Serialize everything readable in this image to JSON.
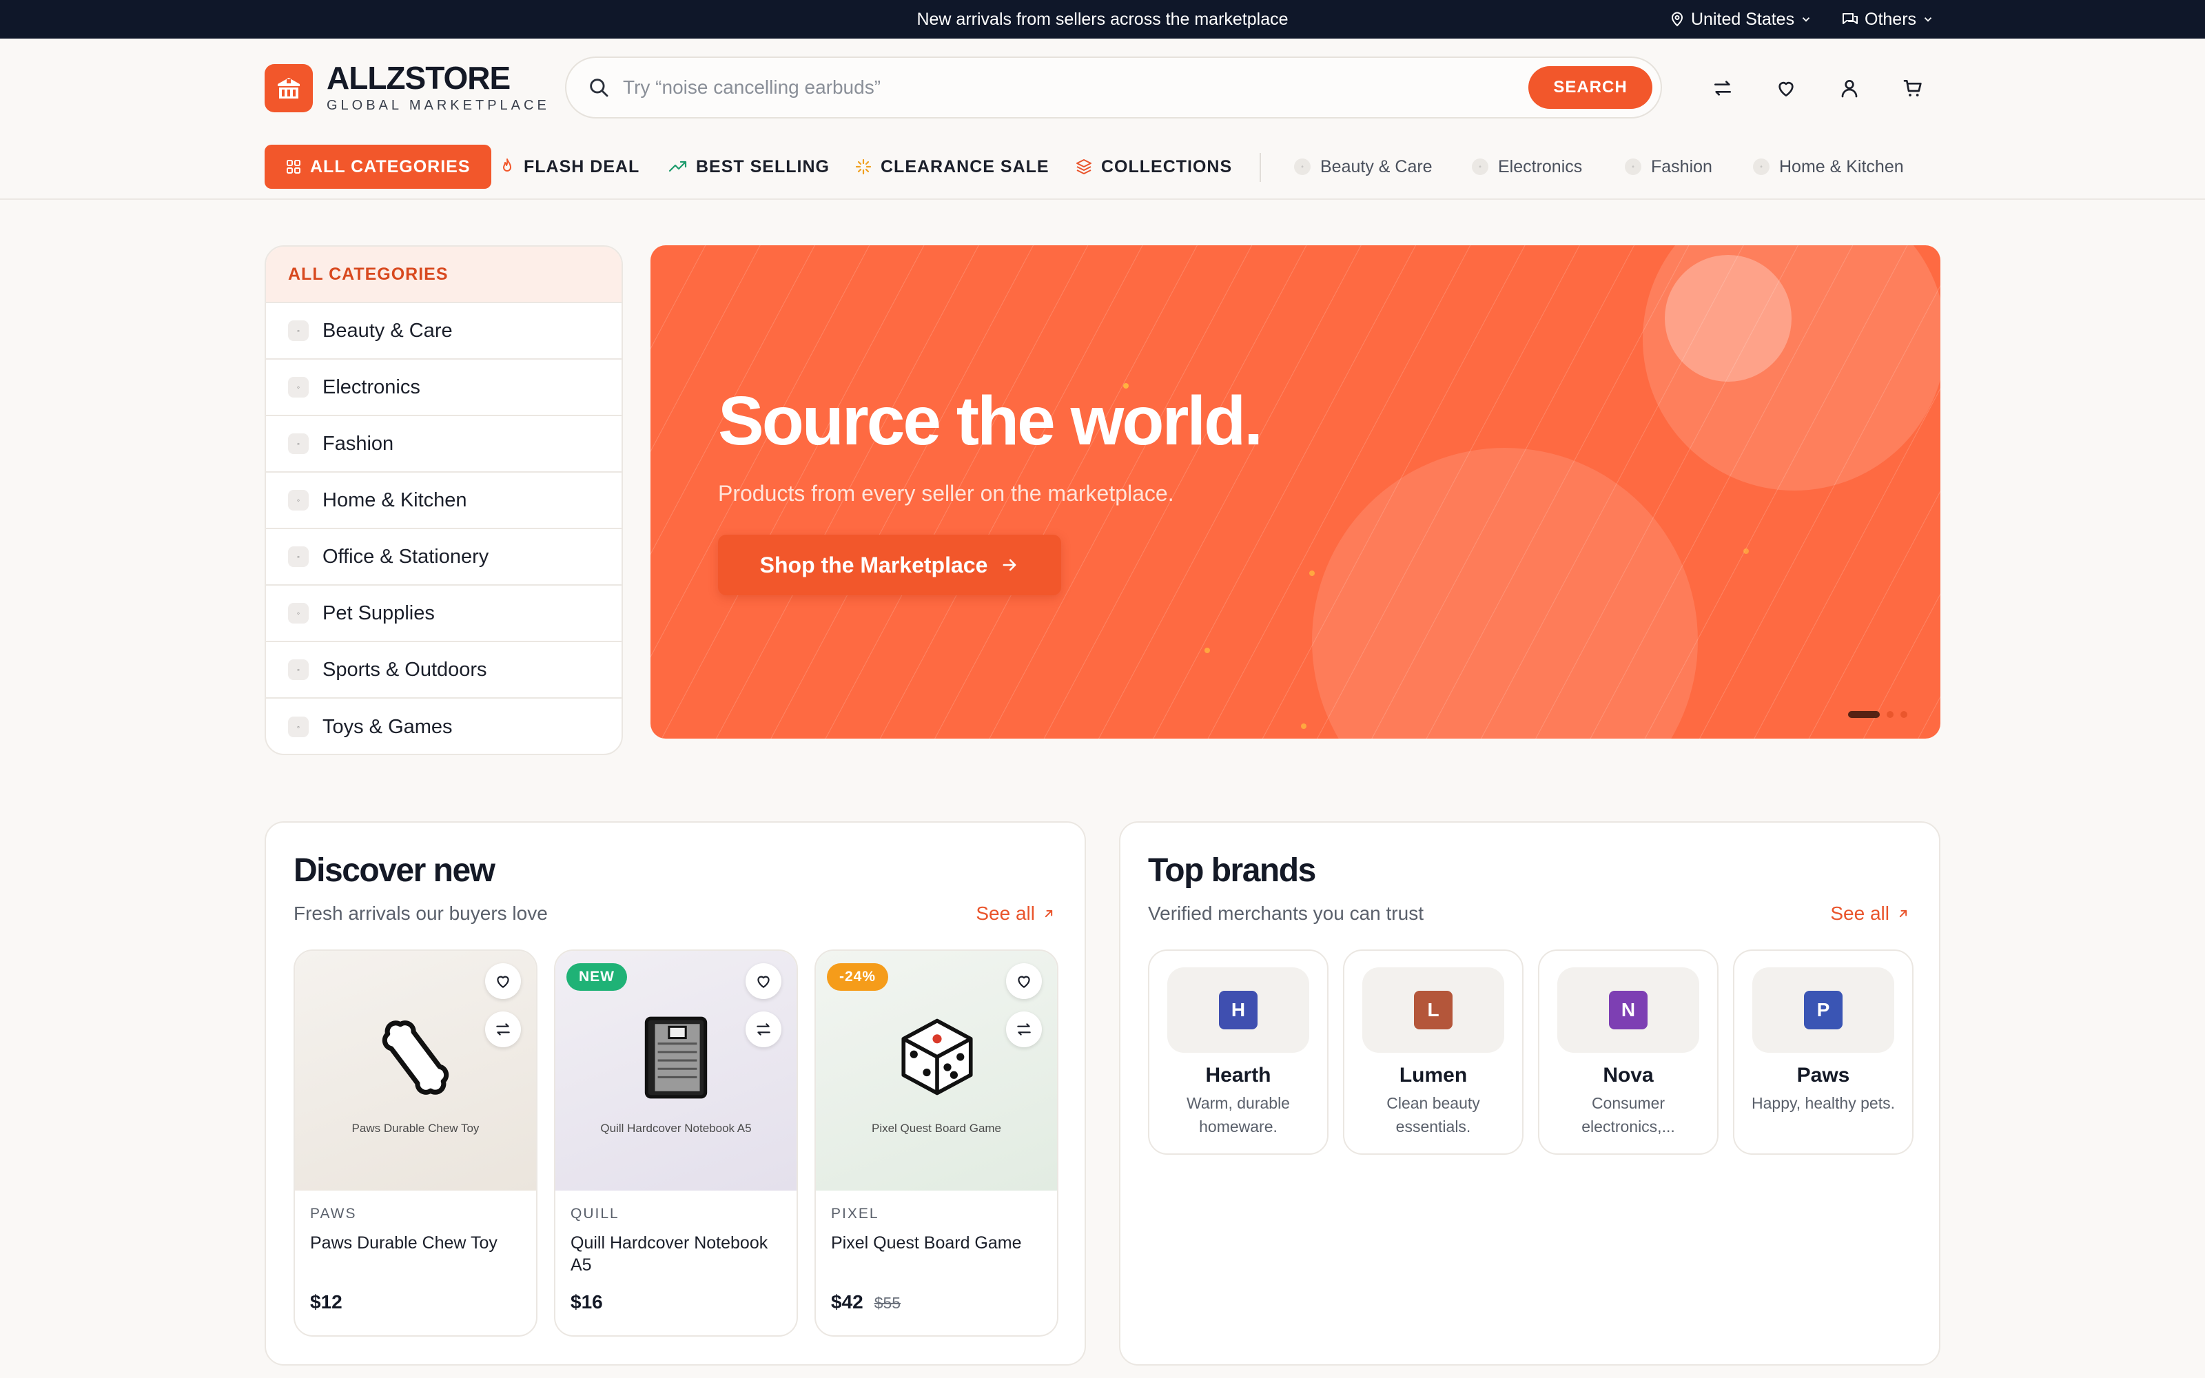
{
  "topbar": {
    "message": "New arrivals from sellers across the marketplace",
    "region": "United States",
    "others": "Others"
  },
  "header": {
    "logo_name": "ALLZSTORE",
    "logo_tagline": "GLOBAL MARKETPLACE",
    "search_placeholder": "Try “noise cancelling earbuds”",
    "search_button": "SEARCH",
    "icons": [
      "compare-icon",
      "heart-icon",
      "user-icon",
      "cart-icon"
    ]
  },
  "nav": {
    "all_categories": "ALL CATEGORIES",
    "flash_deal": "FLASH DEAL",
    "best_selling": "BEST SELLING",
    "clearance_sale": "CLEARANCE SALE",
    "collections": "COLLECTIONS",
    "categories": [
      "Beauty & Care",
      "Electronics",
      "Fashion",
      "Home & Kitchen"
    ]
  },
  "sidebar": {
    "title": "ALL CATEGORIES",
    "items": [
      "Beauty & Care",
      "Electronics",
      "Fashion",
      "Home & Kitchen",
      "Office & Stationery",
      "Pet Supplies",
      "Sports & Outdoors",
      "Toys & Games"
    ]
  },
  "hero": {
    "title": "Source the world.",
    "subtitle": "Products from every seller on the marketplace.",
    "cta": "Shop the Marketplace",
    "slide_count": 3,
    "active_slide": 1
  },
  "discover": {
    "title": "Discover new",
    "subtitle": "Fresh arrivals our buyers love",
    "see_all": "See all",
    "products": [
      {
        "brand": "PAWS",
        "name": "Paws Durable Chew Toy",
        "image_label": "Paws Durable Chew Toy",
        "price": "$12",
        "was": "",
        "tag": "",
        "icon": "bone-icon"
      },
      {
        "brand": "QUILL",
        "name": "Quill Hardcover Notebook A5",
        "image_label": "Quill Hardcover Notebook A5",
        "price": "$16",
        "was": "",
        "tag": "NEW",
        "icon": "notebook-icon"
      },
      {
        "brand": "PIXEL",
        "name": "Pixel Quest Board Game",
        "image_label": "Pixel Quest Board Game",
        "price": "$42",
        "was": "$55",
        "tag": "-24%",
        "icon": "dice-icon"
      }
    ]
  },
  "brands": {
    "title": "Top brands",
    "subtitle": "Verified merchants you can trust",
    "see_all": "See all",
    "items": [
      {
        "letter": "H",
        "name": "Hearth",
        "desc": "Warm, durable homeware.",
        "color": "#3f4fb0"
      },
      {
        "letter": "L",
        "name": "Lumen",
        "desc": "Clean beauty essentials.",
        "color": "#b4563a"
      },
      {
        "letter": "N",
        "name": "Nova",
        "desc": "Consumer electronics,...",
        "color": "#7d3fb3"
      },
      {
        "letter": "P",
        "name": "Paws",
        "desc": "Happy, healthy pets.",
        "color": "#3a55b4"
      }
    ]
  },
  "colors": {
    "accent": "#f2572b",
    "hero_bg": "#fe6a42",
    "topbar_bg": "#0f1729"
  }
}
